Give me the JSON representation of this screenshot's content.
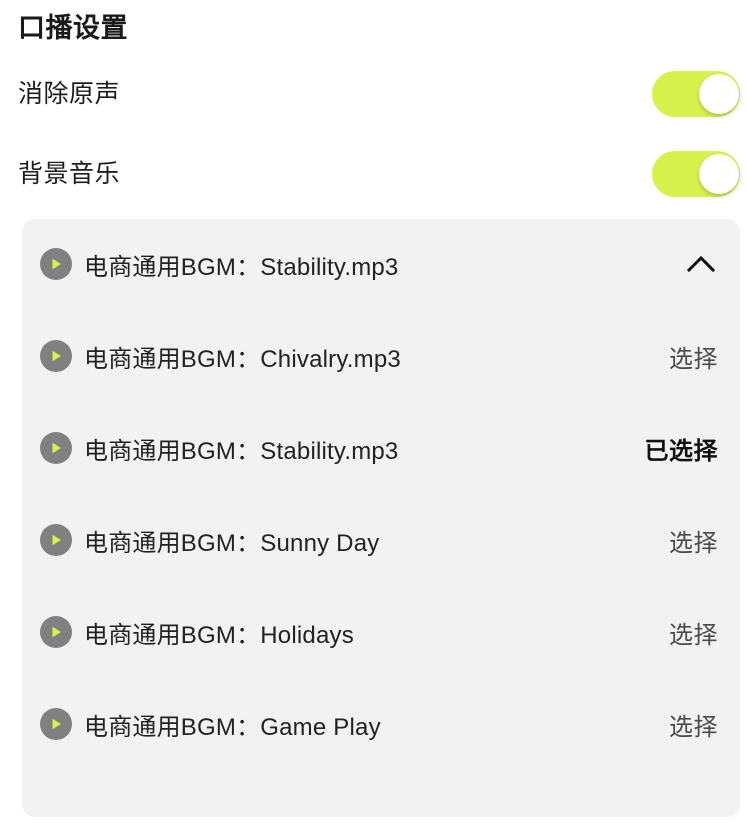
{
  "page": {
    "title": "口播设置",
    "background_color": "#ffffff"
  },
  "theme": {
    "accent_color": "#d8f24d",
    "panel_color": "#f2f2f2",
    "play_icon_color": "#808080",
    "text_color": "#1d1d1d"
  },
  "settings": [
    {
      "label": "消除原声",
      "toggle_state": "on",
      "icon": "toggle-switch"
    },
    {
      "label": "背景音乐",
      "toggle_state": "on",
      "icon": "toggle-switch"
    }
  ],
  "bgm_panel": {
    "collapse_icon": "chevron-up-icon",
    "items": [
      {
        "play_icon": "play-circle-icon",
        "title": "电商通用BGM：Stability.mp3",
        "action_label": "",
        "selected": false,
        "has_chevron": true
      },
      {
        "play_icon": "play-circle-icon",
        "title": "电商通用BGM：Chivalry.mp3",
        "action_label": "选择",
        "selected": false,
        "has_chevron": false
      },
      {
        "play_icon": "play-circle-icon",
        "title": "电商通用BGM：Stability.mp3",
        "action_label": "已选择",
        "selected": true,
        "has_chevron": false
      },
      {
        "play_icon": "play-circle-icon",
        "title": "电商通用BGM：Sunny Day",
        "action_label": "选择",
        "selected": false,
        "has_chevron": false
      },
      {
        "play_icon": "play-circle-icon",
        "title": "电商通用BGM：Holidays",
        "action_label": "选择",
        "selected": false,
        "has_chevron": false
      },
      {
        "play_icon": "play-circle-icon",
        "title": "电商通用BGM：Game Play",
        "action_label": "选择",
        "selected": false,
        "has_chevron": false
      }
    ]
  }
}
